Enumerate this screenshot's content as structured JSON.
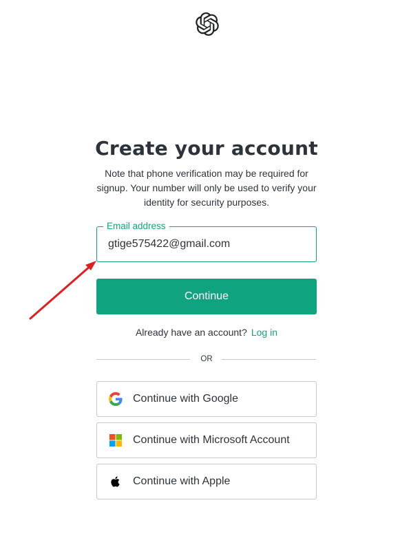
{
  "logo": {
    "icon": "openai-logo-icon"
  },
  "heading": "Create your account",
  "note": "Note that phone verification may be required for signup. Your number will only be used to verify your identity for security purposes.",
  "email_field": {
    "label": "Email address",
    "value": "gtige575422@gmail.com"
  },
  "continue_label": "Continue",
  "login_prompt": {
    "text": "Already have an account?",
    "link": "Log in"
  },
  "divider_text": "OR",
  "social_buttons": [
    {
      "label": "Continue with Google",
      "icon": "google-icon"
    },
    {
      "label": "Continue with Microsoft Account",
      "icon": "microsoft-icon"
    },
    {
      "label": "Continue with Apple",
      "icon": "apple-icon"
    }
  ],
  "colors": {
    "accent": "#10a37f",
    "text": "#2d333a",
    "border": "#c2c8d0",
    "annotation_arrow": "#e01e1e"
  }
}
